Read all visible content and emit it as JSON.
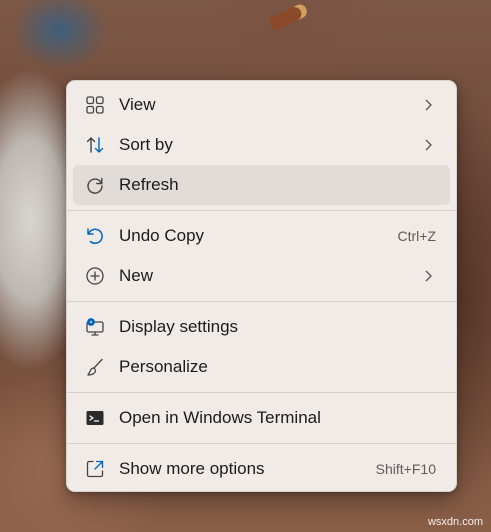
{
  "context_menu": {
    "items": [
      {
        "label": "View",
        "icon": "grid-icon",
        "submenu": true
      },
      {
        "label": "Sort by",
        "icon": "sort-arrows-icon",
        "submenu": true
      },
      {
        "label": "Refresh",
        "icon": "refresh-icon",
        "highlighted": true
      },
      {
        "label": "Undo Copy",
        "icon": "undo-icon",
        "shortcut": "Ctrl+Z"
      },
      {
        "label": "New",
        "icon": "new-plus-icon",
        "submenu": true
      },
      {
        "label": "Display settings",
        "icon": "display-settings-icon"
      },
      {
        "label": "Personalize",
        "icon": "brush-icon"
      },
      {
        "label": "Open in Windows Terminal",
        "icon": "terminal-icon"
      },
      {
        "label": "Show more options",
        "icon": "expand-icon",
        "shortcut": "Shift+F10"
      }
    ]
  },
  "watermark": "wsxdn.com",
  "colors": {
    "accent": "#0067c0",
    "menu_bg": "#f1ebe8",
    "hover_bg": "#e2dcd9"
  }
}
